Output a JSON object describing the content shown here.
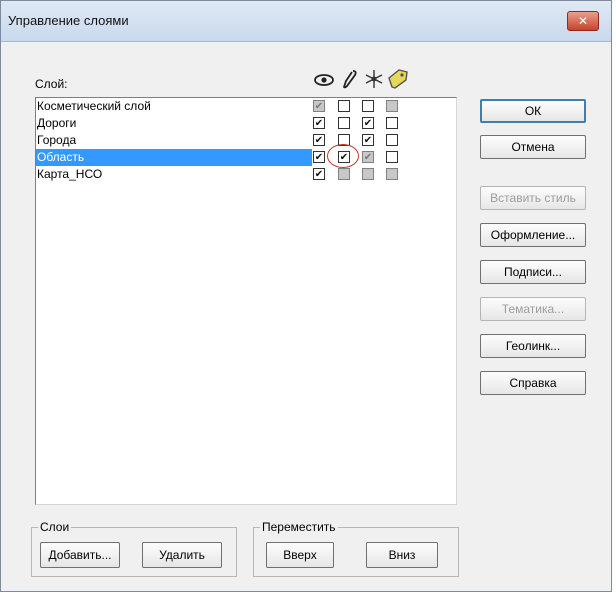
{
  "window": {
    "title": "Управление слоями",
    "close": "✕"
  },
  "list": {
    "header": "Слой:",
    "columns": [
      "visible-eye-icon",
      "edit-pencil-icon",
      "select-cursor-icon",
      "label-tag-icon"
    ],
    "rows": [
      {
        "name": "Косметический слой",
        "flags": [
          "grey-checked",
          "unchecked",
          "unchecked",
          "grey"
        ]
      },
      {
        "name": "Дороги",
        "flags": [
          "checked",
          "unchecked",
          "checked",
          "unchecked"
        ]
      },
      {
        "name": "Города",
        "flags": [
          "checked",
          "unchecked",
          "checked",
          "unchecked"
        ]
      },
      {
        "name": "Область",
        "flags": [
          "checked",
          "checked",
          "grey-checked",
          "unchecked"
        ],
        "selected": true
      },
      {
        "name": "Карта_НСО",
        "flags": [
          "checked",
          "grey",
          "grey",
          "grey"
        ]
      }
    ]
  },
  "buttons": {
    "ok": "ОК",
    "cancel": "Отмена",
    "paste_style": "Вставить стиль",
    "design": "Оформление...",
    "labels": "Подписи...",
    "thematic": "Тематика...",
    "geolink": "Геолинк...",
    "help": "Справка"
  },
  "groups": {
    "layers": {
      "legend": "Слои",
      "add": "Добавить...",
      "remove": "Удалить"
    },
    "move": {
      "legend": "Переместить",
      "up": "Вверх",
      "down": "Вниз"
    }
  },
  "colors": {
    "selection": "#3399ff",
    "highlight_circle": "#c0392b"
  }
}
